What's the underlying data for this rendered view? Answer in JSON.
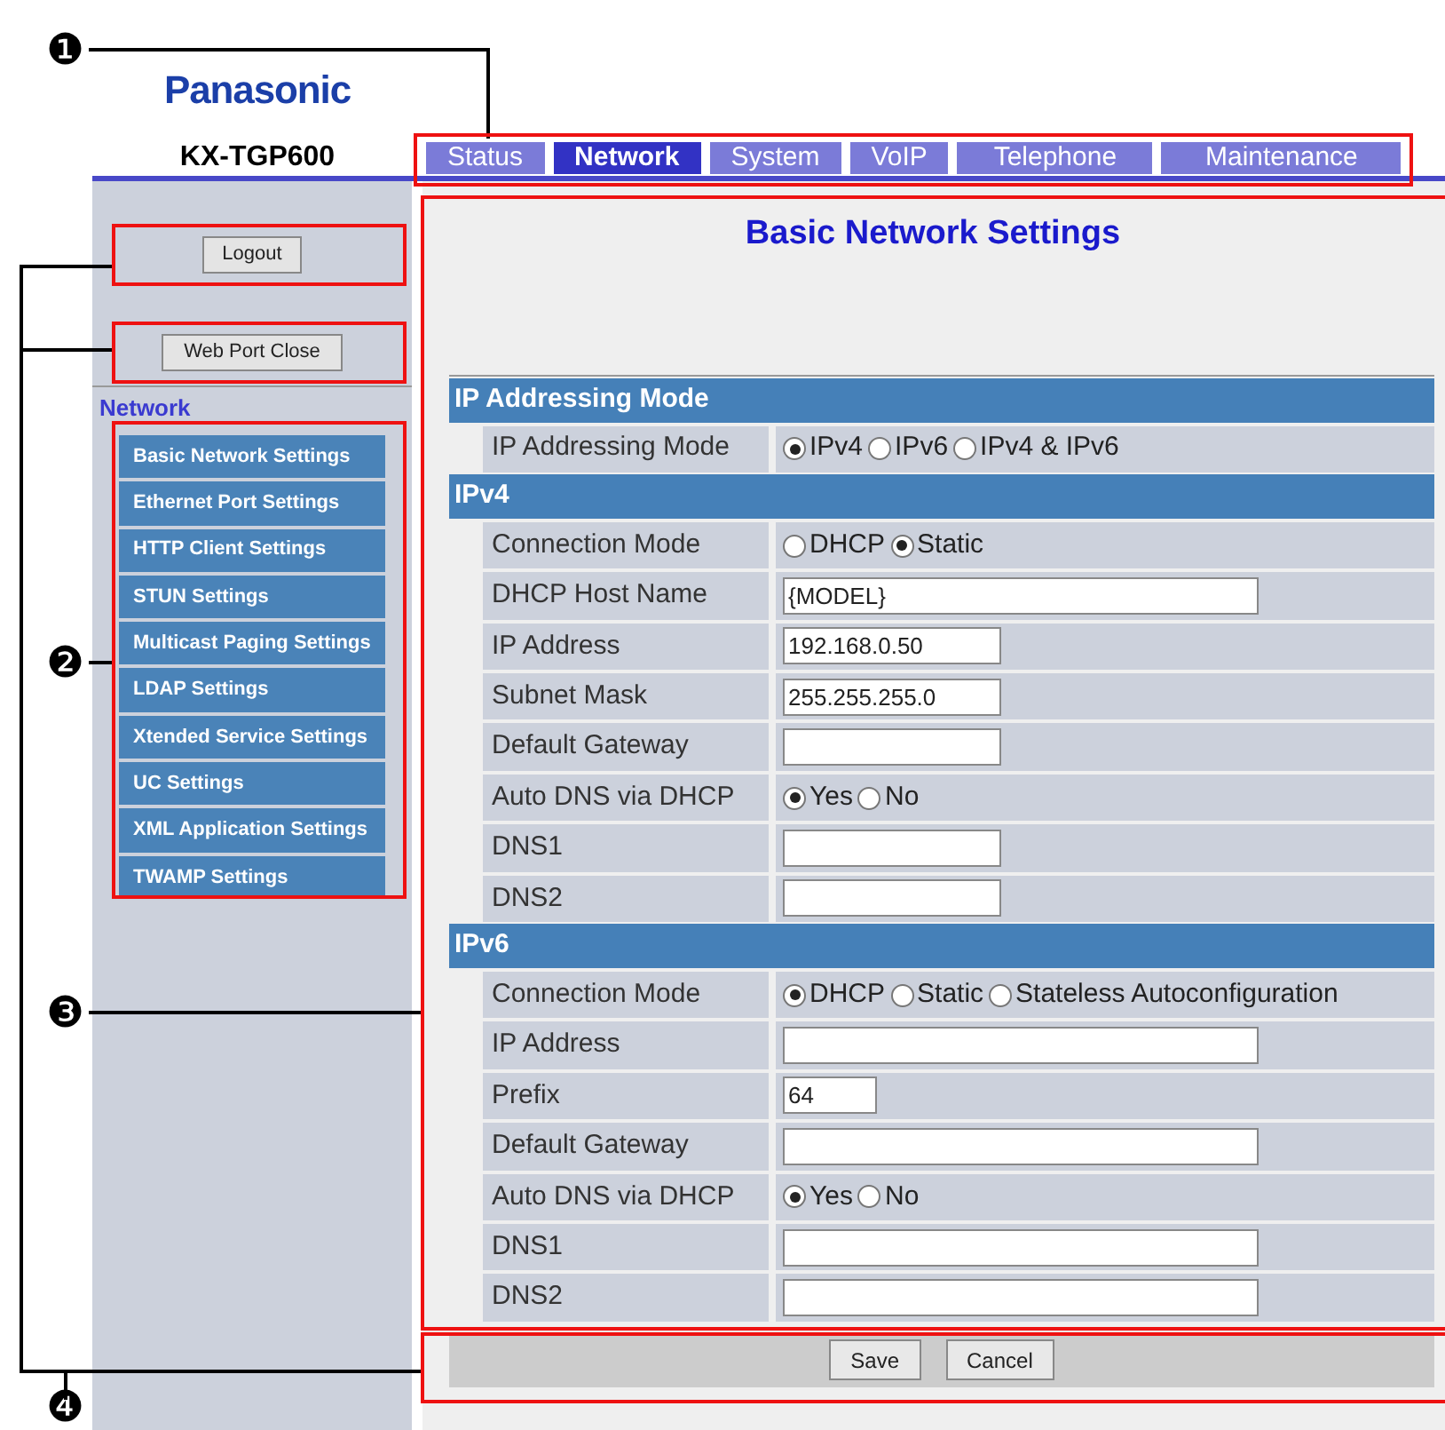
{
  "logo": "Panasonic",
  "model": "KX-TGP600",
  "tabs": [
    {
      "label": "Status",
      "selected": false
    },
    {
      "label": "Network",
      "selected": true
    },
    {
      "label": "System",
      "selected": false
    },
    {
      "label": "VoIP",
      "selected": false
    },
    {
      "label": "Telephone",
      "selected": false
    },
    {
      "label": "Maintenance",
      "selected": false
    }
  ],
  "sidebar": {
    "buttons": [
      "Logout",
      "Web Port Close"
    ],
    "heading": "Network",
    "items": [
      {
        "label": "Basic Network Settings"
      },
      {
        "label": "Ethernet Port Settings"
      },
      {
        "label": "HTTP Client Settings"
      },
      {
        "label": "STUN Settings"
      },
      {
        "label": "Multicast Paging Settings"
      },
      {
        "label": "LDAP Settings"
      },
      {
        "label": "Xtended Service Settings"
      },
      {
        "label": "UC Settings"
      },
      {
        "label": "XML Application Settings"
      },
      {
        "label": "TWAMP Settings"
      }
    ]
  },
  "page_title": "Basic Network Settings",
  "sections": [
    {
      "title": "IP Addressing Mode",
      "rows": [
        {
          "label": "IP Addressing Mode",
          "kind": "radio",
          "options": [
            {
              "label": "IPv4",
              "selected": true
            },
            {
              "label": "IPv6",
              "selected": false
            },
            {
              "label": "IPv4 & IPv6",
              "selected": false
            }
          ]
        }
      ]
    },
    {
      "title": "IPv4",
      "rows": [
        {
          "label": "Connection Mode",
          "kind": "radio",
          "options": [
            {
              "label": "DHCP",
              "selected": false
            },
            {
              "label": "Static",
              "selected": true
            }
          ]
        },
        {
          "label": "DHCP Host Name",
          "kind": "longtext",
          "value": "{MODEL}"
        },
        {
          "label": "IP Address",
          "kind": "shorttext",
          "value": "192.168.0.50"
        },
        {
          "label": "Subnet Mask",
          "kind": "shorttext",
          "value": "255.255.255.0"
        },
        {
          "label": "Default Gateway",
          "kind": "shorttext"
        },
        {
          "label": "Auto DNS via DHCP",
          "kind": "radio",
          "options": [
            {
              "label": "Yes",
              "selected": true
            },
            {
              "label": "No",
              "selected": false
            }
          ]
        },
        {
          "label": "DNS1",
          "kind": "shorttext"
        },
        {
          "label": "DNS2",
          "kind": "shorttext"
        }
      ]
    },
    {
      "title": "IPv6",
      "rows": [
        {
          "label": "Connection Mode",
          "kind": "radio",
          "options": [
            {
              "label": "DHCP",
              "selected": true
            },
            {
              "label": "Static",
              "selected": false
            },
            {
              "label": "Stateless Autoconfiguration",
              "selected": false
            }
          ]
        },
        {
          "label": "IP Address",
          "kind": "longtext"
        },
        {
          "label": "Prefix",
          "kind": "tinytext",
          "value": "64"
        },
        {
          "label": "Default Gateway",
          "kind": "longtext"
        },
        {
          "label": "Auto DNS via DHCP",
          "kind": "radio",
          "options": [
            {
              "label": "Yes",
              "selected": true
            },
            {
              "label": "No",
              "selected": false
            }
          ]
        },
        {
          "label": "DNS1",
          "kind": "longtext"
        },
        {
          "label": "DNS2",
          "kind": "longtext"
        }
      ]
    }
  ],
  "footer_buttons": [
    "Save",
    "Cancel"
  ],
  "callouts": [
    "❶",
    "❷",
    "❸",
    "❹"
  ]
}
